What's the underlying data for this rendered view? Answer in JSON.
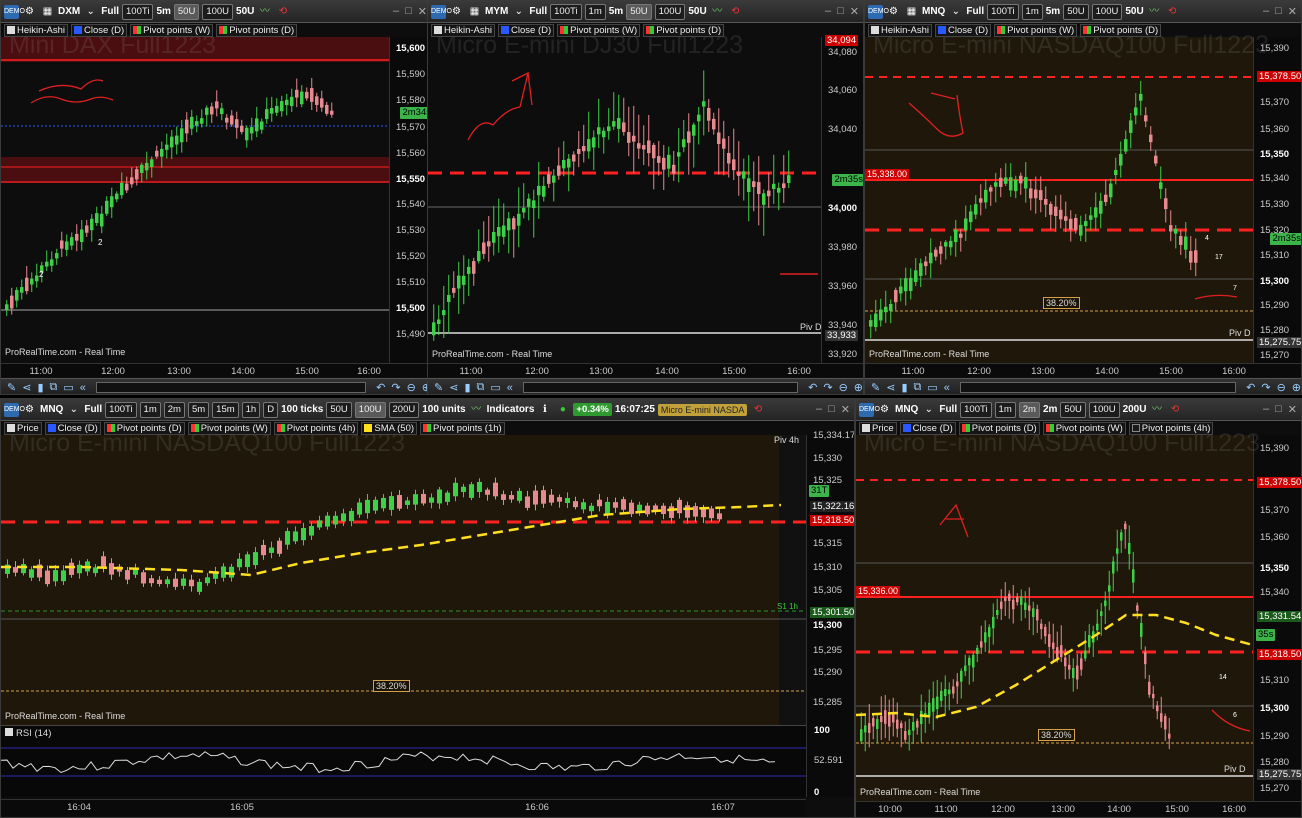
{
  "brand": "ProRealTime.com - Real Time",
  "colors": {
    "bull": "#3fd04a",
    "bear": "#e78a90",
    "pivot": "#ff2020",
    "sma": "#ffe020",
    "zone": "#2a1f0a",
    "band": "#5a0f12"
  },
  "windows": [
    {
      "id": "dax",
      "toolbar": {
        "symbol": "DXM",
        "mode": "Full",
        "buttons": [
          "100Ti",
          "5m",
          "50U",
          "100U",
          "50U"
        ],
        "selected_tf": "5m"
      },
      "legend": [
        {
          "label": "Heikin-Ashi",
          "color": "#dddddd"
        },
        {
          "label": "Close (D)",
          "color": "#2a58ff"
        },
        {
          "label": "Pivot points (W)",
          "color": "#ff3030"
        },
        {
          "label": "Pivot points (D)",
          "color": "#ff3030"
        }
      ],
      "watermark": "Mini DAX Full1223",
      "prices": [
        "15,600",
        "15,590",
        "15,580",
        "15,570",
        "15,560",
        "15,550",
        "15,540",
        "15,530",
        "15,520",
        "15,510",
        "15,500",
        "15,490"
      ],
      "bold_price": [
        "15,600",
        "15,550",
        "15,500"
      ],
      "times": [
        "11:00",
        "12:00",
        "13:00",
        "14:00",
        "15:00",
        "16:00"
      ],
      "timer": "2m34s",
      "annotations": [
        "2",
        "2"
      ]
    },
    {
      "id": "ym",
      "toolbar": {
        "symbol": "MYM",
        "mode": "Full",
        "buttons": [
          "100Ti",
          "1m",
          "5m",
          "50U",
          "100U",
          "50U"
        ],
        "selected_tf": "5m"
      },
      "legend": [
        {
          "label": "Heikin-Ashi",
          "color": "#dddddd"
        },
        {
          "label": "Close (D)",
          "color": "#2a58ff"
        },
        {
          "label": "Pivot points (W)",
          "color": "#ff3030"
        },
        {
          "label": "Pivot points (D)",
          "color": "#ff3030"
        }
      ],
      "watermark": "Micro E-mini DJ30 Full1223",
      "prices": [
        "34,094",
        "34,080",
        "34,060",
        "34,040",
        "34,000",
        "33,980",
        "33,960",
        "33,940",
        "33,933",
        "33,920"
      ],
      "bold_price": [
        "34,000"
      ],
      "times": [
        "11:00",
        "12:00",
        "13:00",
        "14:00",
        "15:00",
        "16:00"
      ],
      "timer": "2m35s",
      "pivot_label": "Piv D"
    },
    {
      "id": "nq5",
      "toolbar": {
        "symbol": "MNQ",
        "mode": "Full",
        "buttons": [
          "100Ti",
          "1m",
          "5m",
          "50U",
          "100U",
          "50U"
        ],
        "selected_tf": "5m"
      },
      "legend": [
        {
          "label": "Heikin-Ashi",
          "color": "#dddddd"
        },
        {
          "label": "Close (D)",
          "color": "#2a58ff"
        },
        {
          "label": "Pivot points (W)",
          "color": "#ff3030"
        },
        {
          "label": "Pivot points (D)",
          "color": "#ff3030"
        }
      ],
      "watermark": "Micro E-mini NASDAQ100 Full1223",
      "prices": [
        "15,390",
        "15,378.50",
        "15,370",
        "15,360",
        "15,350",
        "15,340",
        "15,330",
        "15,320",
        "15,310",
        "15,300",
        "15,290",
        "15,280",
        "15,275.75",
        "15,270"
      ],
      "bold_price": [
        "15,350",
        "15,300"
      ],
      "times": [
        "11:00",
        "12:00",
        "13:00",
        "14:00",
        "15:00",
        "16:00"
      ],
      "timer": "2m35s",
      "fib": "38.20%",
      "left_tag": "15,338.00",
      "pivot_label": "Piv D",
      "annotations": [
        "4",
        "17",
        "7"
      ]
    },
    {
      "id": "nqticks",
      "toolbar": {
        "symbol": "MNQ",
        "mode": "Full",
        "buttons": [
          "100Ti",
          "1m",
          "2m",
          "5m",
          "15m",
          "1h",
          "D"
        ],
        "ticks": "100 ticks",
        "units_btns": [
          "50U",
          "100U",
          "200U"
        ],
        "units": "100 units",
        "indicators": "Indicators",
        "change": "+0.34%",
        "clock": "16:07:25",
        "instrument": "Micro E-mini NASDA"
      },
      "legend": [
        {
          "label": "Price",
          "color": "#dddddd"
        },
        {
          "label": "Close (D)",
          "color": "#2a58ff"
        },
        {
          "label": "Pivot points (D)",
          "color": "#ff3030"
        },
        {
          "label": "Pivot points (W)",
          "color": "#ff3030"
        },
        {
          "label": "Pivot points (4h)",
          "color": "#ff3030"
        },
        {
          "label": "SMA (50)",
          "color": "#ffe020"
        },
        {
          "label": "Pivot points (1h)",
          "color": "#ff3030"
        }
      ],
      "watermark": "Micro E-mini NASDAQ100 Full1223",
      "prices": [
        "15,334.17",
        "15,330",
        "15,325",
        "15,322.16",
        "15,318.50",
        "15,315",
        "15,310",
        "15,305",
        "15,301.50",
        "15,300",
        "15,295",
        "15,290",
        "15,285"
      ],
      "bold_price": [
        "15,300"
      ],
      "times": [
        "16:04",
        "16:05",
        "16:06",
        "16:07"
      ],
      "fib": "38.20%",
      "count": "31T",
      "piv4h": "Piv 4h",
      "s1": "S1 1h",
      "rsi": {
        "label": "RSI (14)",
        "value": "52.591",
        "top": "100",
        "bottom": "0"
      }
    },
    {
      "id": "nq2m",
      "toolbar": {
        "symbol": "MNQ",
        "mode": "Full",
        "buttons": [
          "100Ti",
          "1m",
          "2m",
          "2m",
          "50U",
          "100U",
          "200U"
        ],
        "selected_tf": "2m"
      },
      "legend": [
        {
          "label": "Price",
          "color": "#dddddd"
        },
        {
          "label": "Close (D)",
          "color": "#2a58ff"
        },
        {
          "label": "Pivot points (D)",
          "color": "#ff3030"
        },
        {
          "label": "Pivot points (W)",
          "color": "#ff3030"
        },
        {
          "label": "Pivot points (4h)",
          "color": "#ff3030"
        }
      ],
      "watermark": "Micro E-mini NASDAQ100 Full1223",
      "prices": [
        "15,390",
        "15,378.50",
        "15,370",
        "15,360",
        "15,350",
        "15,340",
        "15,331.54",
        "15,318.50",
        "15,310",
        "15,300",
        "15,290",
        "15,280",
        "15,275.75",
        "15,270"
      ],
      "bold_price": [
        "15,350",
        "15,300"
      ],
      "times": [
        "10:00",
        "11:00",
        "12:00",
        "13:00",
        "14:00",
        "15:00",
        "16:00"
      ],
      "timer": "35s",
      "fib": "38.20%",
      "left_tag": "15,336.00",
      "pivot_label": "Piv D",
      "annotations": [
        "14",
        "6"
      ]
    }
  ]
}
